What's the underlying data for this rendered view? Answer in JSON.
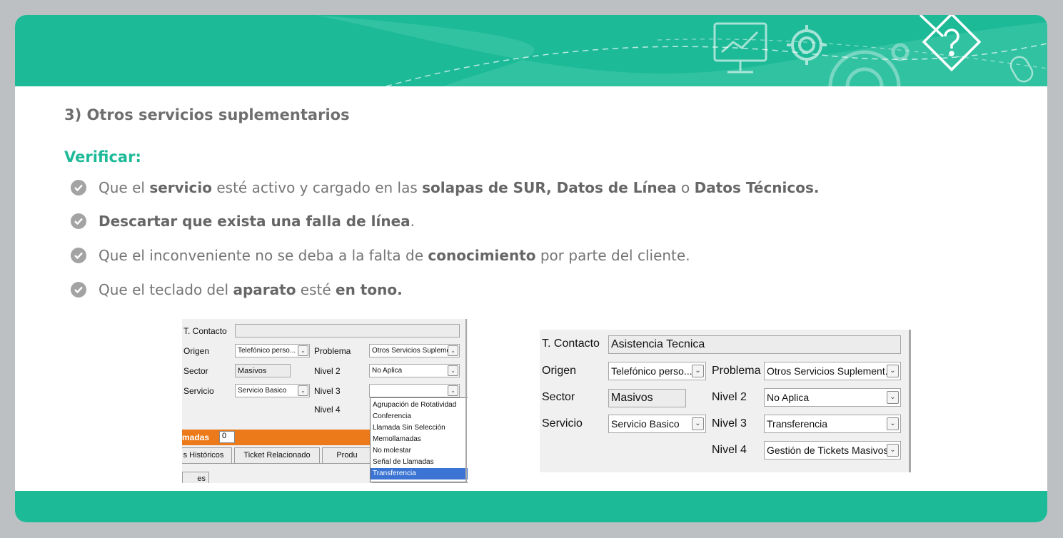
{
  "slide": {
    "title": "3) Otros servicios suplementarios",
    "verify_label": "Verificar:",
    "bullets": [
      {
        "segments": [
          {
            "text": "Que el ",
            "bold": false
          },
          {
            "text": "servicio",
            "bold": true
          },
          {
            "text": " esté activo y cargado en las ",
            "bold": false
          },
          {
            "text": "solapas de SUR, Datos de Línea",
            "bold": true
          },
          {
            "text": " o ",
            "bold": false
          },
          {
            "text": "Datos Técnicos.",
            "bold": true
          }
        ]
      },
      {
        "segments": [
          {
            "text": "Descartar que exista una falla de línea",
            "bold": true
          },
          {
            "text": ".",
            "bold": false
          }
        ]
      },
      {
        "segments": [
          {
            "text": "Que el inconveniente no se deba a la falta de ",
            "bold": false
          },
          {
            "text": "conocimiento",
            "bold": true
          },
          {
            "text": " por parte del cliente.",
            "bold": false
          }
        ]
      },
      {
        "segments": [
          {
            "text": "Que el teclado del ",
            "bold": false
          },
          {
            "text": "aparato",
            "bold": true
          },
          {
            "text": " esté ",
            "bold": false
          },
          {
            "text": "en tono.",
            "bold": true
          }
        ]
      }
    ],
    "colors": {
      "accent": "#1dba98",
      "frame": "#bcc0c3",
      "bullet_icon": "#a3a3a3",
      "orange_bar": "#ec7a1a",
      "selected": "#3b74d3"
    },
    "icons": [
      "monitor-icon",
      "gear-icon",
      "pencil-question-icon",
      "mouse-icon"
    ]
  },
  "screenshot1": {
    "labels": {
      "t_contacto": "T. Contacto",
      "origen": "Origen",
      "sector": "Sector",
      "servicio": "Servicio",
      "problema": "Problema",
      "nivel2": "Nivel 2",
      "nivel3": "Nivel 3",
      "nivel4": "Nivel 4"
    },
    "values": {
      "t_contacto": "",
      "origen": "Telefónico perso...",
      "sector": "Masivos",
      "servicio": "Servicio Basico",
      "problema": "Otros Servicios Suplement...",
      "nivel2": "No Aplica",
      "nivel3": ""
    },
    "bar_label": "madas",
    "bar_count": "0",
    "tabs": [
      "s Históricos",
      "Ticket Relacionado",
      "Produ"
    ],
    "subtab": "es",
    "dropdown_options": [
      "Agrupación de Rotatividad",
      "Conferencia",
      "Llamada Sin Selección",
      "Memollamadas",
      "No molestar",
      "Señal de Llamadas",
      "Transferencia"
    ],
    "selected_option": "Transferencia"
  },
  "screenshot2": {
    "labels": {
      "t_contacto": "T. Contacto",
      "origen": "Origen",
      "sector": "Sector",
      "servicio": "Servicio",
      "problema": "Problema",
      "nivel2": "Nivel 2",
      "nivel3": "Nivel 3",
      "nivel4": "Nivel 4"
    },
    "values": {
      "t_contacto": "Asistencia Tecnica",
      "origen": "Telefónico perso...",
      "sector": "Masivos",
      "servicio": "Servicio Basico",
      "problema": "Otros Servicios Suplement...",
      "nivel2": "No Aplica",
      "nivel3": "Transferencia",
      "nivel4": "Gestión de Tickets Masivos"
    }
  }
}
